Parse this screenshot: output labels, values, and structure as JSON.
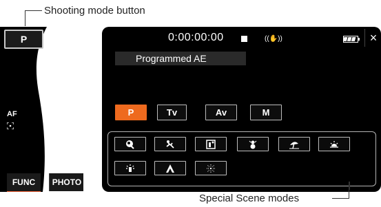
{
  "callouts": {
    "top_label": "Shooting mode button",
    "bottom_label": "Special Scene modes"
  },
  "left_panel": {
    "mode_button": "P",
    "af_label": "AF",
    "func_button": "FUNC",
    "photo_button": "PHOTO"
  },
  "screen": {
    "timecode": "0:00:00:00",
    "title": "Programmed AE",
    "close_label": "×",
    "icons": {
      "stop": "stop-icon",
      "stabilizer": "stabilizer-icon",
      "battery": "battery-icon"
    },
    "modes": [
      {
        "label": "P",
        "selected": true
      },
      {
        "label": "Tv",
        "selected": false
      },
      {
        "label": "Av",
        "selected": false
      },
      {
        "label": "M",
        "selected": false
      }
    ],
    "scene_icons": [
      "portrait-icon",
      "sports-icon",
      "night-scene-icon",
      "snow-icon",
      "beach-icon",
      "sunset-icon",
      "low-light-icon",
      "spotlight-icon",
      "fireworks-icon"
    ]
  },
  "colors": {
    "accent": "#ee6a1e",
    "screen_bg": "#000000",
    "button_border": "#bdbdbd"
  }
}
